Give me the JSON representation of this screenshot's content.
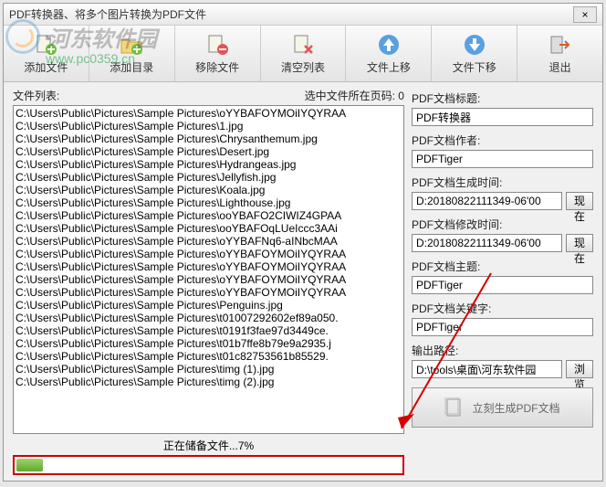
{
  "window": {
    "title": "PDF转换器、将多个图片转换为PDF文件",
    "close": "×"
  },
  "watermark": {
    "text": "河东软件园",
    "url": "www.pc0359.cn"
  },
  "toolbar": {
    "add_file": "添加文件",
    "add_dir": "添加目录",
    "remove_file": "移除文件",
    "clear_list": "清空列表",
    "file_up": "文件上移",
    "file_down": "文件下移",
    "exit": "退出"
  },
  "left": {
    "list_label": "文件列表:",
    "page_label": "选中文件所在页码:",
    "page_value": "0",
    "files": [
      "C:\\Users\\Public\\Pictures\\Sample Pictures\\oYYBAFOYMOiIYQYRAA",
      "C:\\Users\\Public\\Pictures\\Sample Pictures\\1.jpg",
      "C:\\Users\\Public\\Pictures\\Sample Pictures\\Chrysanthemum.jpg",
      "C:\\Users\\Public\\Pictures\\Sample Pictures\\Desert.jpg",
      "C:\\Users\\Public\\Pictures\\Sample Pictures\\Hydrangeas.jpg",
      "C:\\Users\\Public\\Pictures\\Sample Pictures\\Jellyfish.jpg",
      "C:\\Users\\Public\\Pictures\\Sample Pictures\\Koala.jpg",
      "C:\\Users\\Public\\Pictures\\Sample Pictures\\Lighthouse.jpg",
      "C:\\Users\\Public\\Pictures\\Sample Pictures\\ooYBAFO2CIWIZ4GPAA",
      "C:\\Users\\Public\\Pictures\\Sample Pictures\\ooYBAFOqLUeIccc3AAi",
      "C:\\Users\\Public\\Pictures\\Sample Pictures\\oYYBAFNq6-aINbcMAA",
      "C:\\Users\\Public\\Pictures\\Sample Pictures\\oYYBAFOYMOiIYQYRAA",
      "C:\\Users\\Public\\Pictures\\Sample Pictures\\oYYBAFOYMOiIYQYRAA",
      "C:\\Users\\Public\\Pictures\\Sample Pictures\\oYYBAFOYMOiIYQYRAA",
      "C:\\Users\\Public\\Pictures\\Sample Pictures\\oYYBAFOYMOiIYQYRAA",
      "C:\\Users\\Public\\Pictures\\Sample Pictures\\Penguins.jpg",
      "C:\\Users\\Public\\Pictures\\Sample Pictures\\t01007292602ef89a050.",
      "C:\\Users\\Public\\Pictures\\Sample Pictures\\t0191f3fae97d3449ce.",
      "C:\\Users\\Public\\Pictures\\Sample Pictures\\t01b7ffe8b79e9a2935.j",
      "C:\\Users\\Public\\Pictures\\Sample Pictures\\t01c82753561b85529.",
      "C:\\Users\\Public\\Pictures\\Sample Pictures\\timg (1).jpg",
      "C:\\Users\\Public\\Pictures\\Sample Pictures\\timg (2).jpg"
    ],
    "progress_text": "正在储备文件...7%",
    "progress_percent": 7
  },
  "right": {
    "title_label": "PDF文档标题:",
    "title_value": "PDF转换器",
    "author_label": "PDF文档作者:",
    "author_value": "PDFTiger",
    "created_label": "PDF文档生成时间:",
    "created_value": "D:20180822111349-06'00",
    "modified_label": "PDF文档修改时间:",
    "modified_value": "D:20180822111349-06'00",
    "subject_label": "PDF文档主题:",
    "subject_value": "PDFTiger",
    "keywords_label": "PDF文档关键字:",
    "keywords_value": "PDFTiger",
    "output_label": "输出路径:",
    "output_value": "D:\\tools\\桌面\\河东软件园",
    "now_btn": "现在",
    "browse_btn": "浏览",
    "generate_btn": "立刻生成PDF文档"
  }
}
